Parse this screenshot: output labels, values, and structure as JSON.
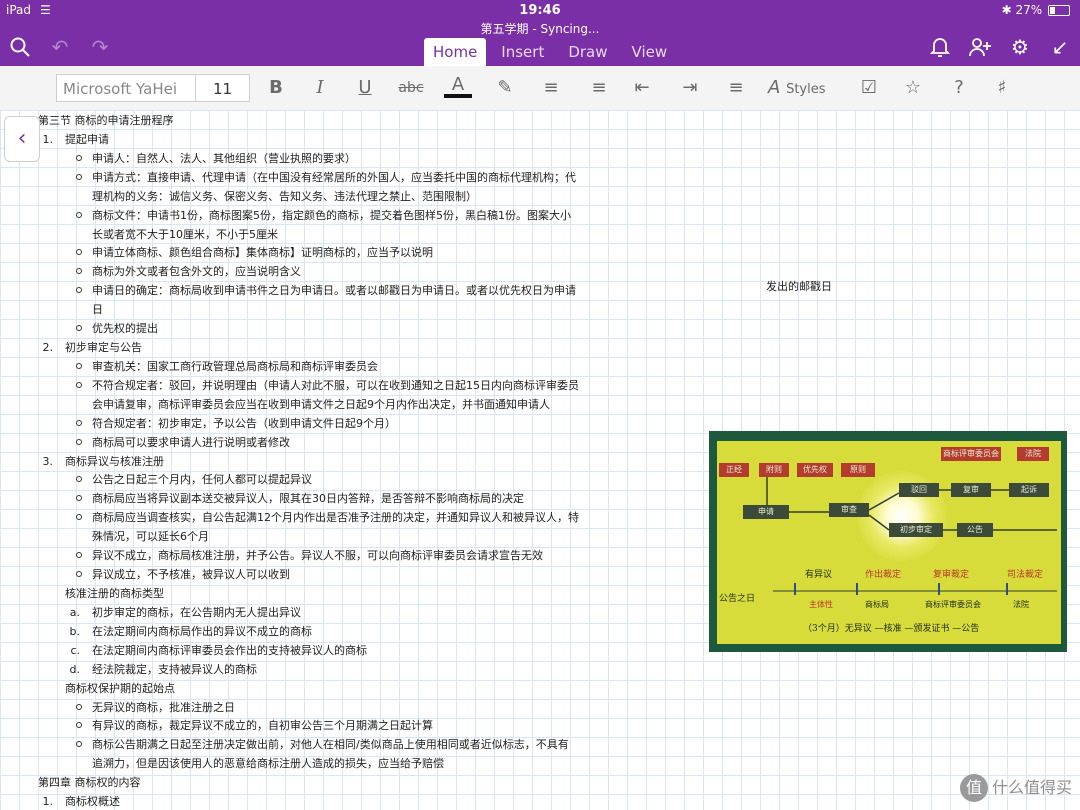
{
  "status": {
    "device": "iPad",
    "time": "19:46",
    "battery": "27%"
  },
  "app": {
    "doc_title": "第五学期 - Syncing...",
    "tabs": [
      "Home",
      "Insert",
      "Draw",
      "View"
    ],
    "active_tab": "Home",
    "icons": [
      "search-icon",
      "undo-icon",
      "redo-icon",
      "bell-icon",
      "add-person-icon",
      "gear-icon",
      "collapse-icon"
    ]
  },
  "toolbar": {
    "font": "Microsoft YaHei",
    "size": "11",
    "styles_label": "Styles"
  },
  "notes": [
    {
      "t": "h",
      "text": "第三节 商标的申请注册程序"
    },
    {
      "t": "n",
      "num": "1.",
      "text": "提起申请"
    },
    {
      "t": "b",
      "text": "申请人：自然人、法人、其他组织（营业执照的要求）"
    },
    {
      "t": "b",
      "text": "申请方式：直接申请、代理申请（在中国没有经常居所的外国人，应当委托中国的商标代理机构；代"
    },
    {
      "t": "c",
      "text": "理机构的义务：诚信义务、保密义务、告知义务、违法代理之禁止、范围限制）"
    },
    {
      "t": "b",
      "text": "商标文件：申请书1份，商标图案5份，指定颜色的商标，提交着色图样5份，黑白稿1份。图案大小"
    },
    {
      "t": "c",
      "text": "长或者宽不大于10厘米，不小于5厘米"
    },
    {
      "t": "b",
      "text": "申请立体商标、颜色组合商标】集体商标】证明商标的，应当予以说明"
    },
    {
      "t": "b",
      "text": "商标为外文或者包含外文的，应当说明含义"
    },
    {
      "t": "b",
      "text": "申请日的确定：商标局收到申请书件之日为申请日。或者以邮戳日为申请日。或者以优先权日为申请"
    },
    {
      "t": "c",
      "text": "日"
    },
    {
      "t": "b",
      "text": "优先权的提出"
    },
    {
      "t": "n",
      "num": "2.",
      "text": "初步审定与公告"
    },
    {
      "t": "b",
      "text": "审查机关：国家工商行政管理总局商标局和商标评审委员会"
    },
    {
      "t": "b",
      "text": "不符合规定者：驳回，并说明理由（申请人对此不服，可以在收到通知之日起15日内向商标评审委员"
    },
    {
      "t": "c",
      "text": "会申请复审，商标评审委员会应当在收到申请文件之日起9个月内作出决定，并书面通知申请人"
    },
    {
      "t": "b",
      "text": "符合规定者：初步审定，予以公告（收到申请文件日起9个月）"
    },
    {
      "t": "b",
      "text": "商标局可以要求申请人进行说明或者修改"
    },
    {
      "t": "n",
      "num": "3.",
      "text": "商标异议与核准注册"
    },
    {
      "t": "b",
      "text": "公告之日起三个月内，任何人都可以提起异议"
    },
    {
      "t": "b",
      "text": "商标局应当将异议副本送交被异议人，限其在30日内答辩，是否答辩不影响商标局的决定"
    },
    {
      "t": "b",
      "text": "商标局应当调查核实，自公告起满12个月内作出是否准予注册的决定，并通知异议人和被异议人，特"
    },
    {
      "t": "c",
      "text": "殊情况，可以延长6个月"
    },
    {
      "t": "b",
      "text": "异议不成立，商标局核准注册，并予公告。异议人不服，可以向商标评审委员会请求宣告无效"
    },
    {
      "t": "b",
      "text": "异议成立，不予核准，被异议人可以收到"
    },
    {
      "t": "p",
      "text": "核准注册的商标类型"
    },
    {
      "t": "a",
      "num": "a.",
      "text": "初步审定的商标，在公告期内无人提出异议"
    },
    {
      "t": "a",
      "num": "b.",
      "text": "在法定期间内商标局作出的异议不成立的商标"
    },
    {
      "t": "a",
      "num": "c.",
      "text": "在法定期间内商标评审委员会作出的支持被异议人的商标"
    },
    {
      "t": "a",
      "num": "d.",
      "text": "经法院裁定，支持被异议人的商标"
    },
    {
      "t": "p",
      "text": "商标权保护期的起始点"
    },
    {
      "t": "b",
      "text": "无异议的商标，批准注册之日"
    },
    {
      "t": "b",
      "text": "有异议的商标，裁定异议不成立的，自初审公告三个月期满之日起计算"
    },
    {
      "t": "b",
      "text": "商标公告期满之日起至注册决定做出前，对他人在相同/类似商品上使用相同或者近似标志，不具有"
    },
    {
      "t": "c",
      "text": "追溯力，但是因该使用人的恶意给商标注册人造成的损失，应当给予赔偿"
    },
    {
      "t": "h",
      "text": "第四章 商标权的内容"
    },
    {
      "t": "n",
      "num": "1.",
      "text": "商标权概述"
    }
  ],
  "side_note": "发出的邮戳日",
  "diagram": {
    "boxes_top": [
      "正经",
      "附则",
      "优先权",
      "原则"
    ],
    "box_apply": "申请",
    "box_review": "审查",
    "box_reject": "驳回",
    "box_reexam": "复审",
    "box_sue": "起诉",
    "box_board": "商标评审委员会",
    "box_court": "法院",
    "box_initial": "初步审定",
    "box_announce": "公告",
    "flow_start": "公告之日",
    "flow_steps": [
      "有异议",
      "作出裁定",
      "复审裁定",
      "司法裁定"
    ],
    "flow_subs": [
      "主体性",
      "商标局",
      "商标评审委员会",
      "法院"
    ],
    "bottom_line": "（3个月）无异议 —核准 —颁发证书 —公告"
  },
  "watermark": {
    "mark": "值",
    "text": "什么值得买"
  }
}
